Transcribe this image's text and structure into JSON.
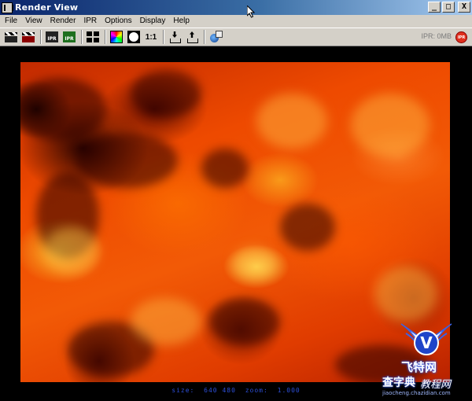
{
  "window": {
    "title": "Render View",
    "buttons": {
      "minimize": "_",
      "maximize": "□",
      "close": "X"
    }
  },
  "menu": {
    "items": [
      "File",
      "View",
      "Render",
      "IPR",
      "Options",
      "Display",
      "Help"
    ]
  },
  "toolbar": {
    "buttons": [
      {
        "name": "render-frame-icon",
        "label": ""
      },
      {
        "name": "render-region-icon",
        "label": ""
      },
      {
        "name": "ipr-render-icon",
        "label": "IPR"
      },
      {
        "name": "refresh-ipr-icon",
        "label": "IPR"
      },
      {
        "name": "render-settings-icon",
        "label": ""
      },
      {
        "name": "rgb-channels-icon",
        "label": ""
      },
      {
        "name": "alpha-channel-icon",
        "label": ""
      },
      {
        "name": "real-size-icon",
        "label": "1:1"
      },
      {
        "name": "keep-image-icon",
        "label": ""
      },
      {
        "name": "remove-image-icon",
        "label": ""
      },
      {
        "name": "render-globals-icon",
        "label": ""
      }
    ],
    "ipr_status": "IPR: 0MB",
    "ipr_badge": "IPR"
  },
  "viewport": {
    "status": {
      "size_label": "size:",
      "size_value": "640 480",
      "zoom_label": "zoom:",
      "zoom_value": "1.000"
    }
  },
  "watermark": {
    "logo_letter": "V",
    "brand": "飞特网",
    "line2_a": "查字典",
    "line2_b": "教程网",
    "url": "jiaocheng.chazidian.com"
  },
  "colors": {
    "titlebar_start": "#0a246a",
    "titlebar_end": "#a6caf0",
    "chrome": "#d4d0c8",
    "status_text": "#2d4fd8",
    "ipr_badge": "#e0301e"
  }
}
